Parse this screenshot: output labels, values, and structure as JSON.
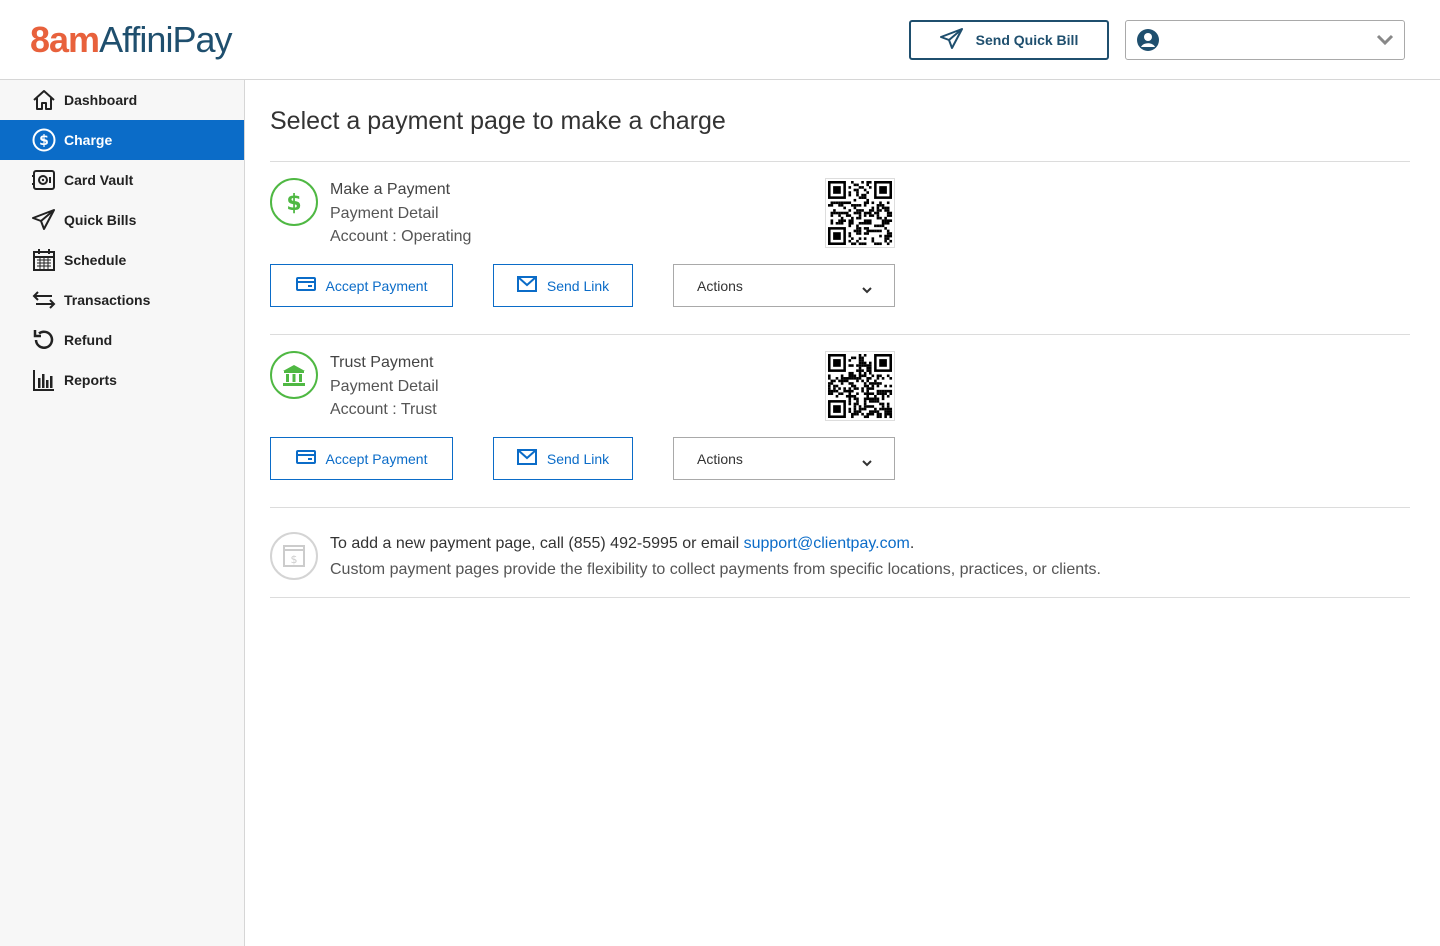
{
  "header": {
    "logo_prefix": "8am",
    "logo_name": "AffiniPay",
    "quick_bill_label": "Send Quick Bill"
  },
  "sidebar": {
    "items": [
      {
        "label": "Dashboard",
        "icon": "home-icon"
      },
      {
        "label": "Charge",
        "icon": "dollar-circle-icon",
        "active": true
      },
      {
        "label": "Card Vault",
        "icon": "vault-icon"
      },
      {
        "label": "Quick Bills",
        "icon": "paper-plane-icon"
      },
      {
        "label": "Schedule",
        "icon": "calendar-icon"
      },
      {
        "label": "Transactions",
        "icon": "transfer-arrows-icon"
      },
      {
        "label": "Refund",
        "icon": "refund-icon"
      },
      {
        "label": "Reports",
        "icon": "bar-chart-icon"
      }
    ]
  },
  "main": {
    "title": "Select a payment page to make a charge",
    "pages": [
      {
        "name": "Make a Payment",
        "detail": "Payment Detail",
        "account": "Account : Operating",
        "icon": "dollar-icon",
        "accept_label": "Accept Payment",
        "send_label": "Send Link",
        "actions_label": "Actions"
      },
      {
        "name": "Trust Payment",
        "detail": "Payment Detail",
        "account": "Account : Trust",
        "icon": "bank-icon",
        "accept_label": "Accept Payment",
        "send_label": "Send Link",
        "actions_label": "Actions"
      }
    ],
    "info": {
      "line1_prefix": "To add a new payment page, call (855) 492-5995 or email ",
      "email": "support@clientpay.com",
      "line1_suffix": ".",
      "line2": "Custom payment pages provide the flexibility to collect payments from specific locations, practices, or clients."
    }
  },
  "colors": {
    "accent": "#0b6cc8",
    "brand_orange": "#e8613c",
    "brand_navy": "#1f4f6e",
    "success_green": "#4fb843"
  }
}
